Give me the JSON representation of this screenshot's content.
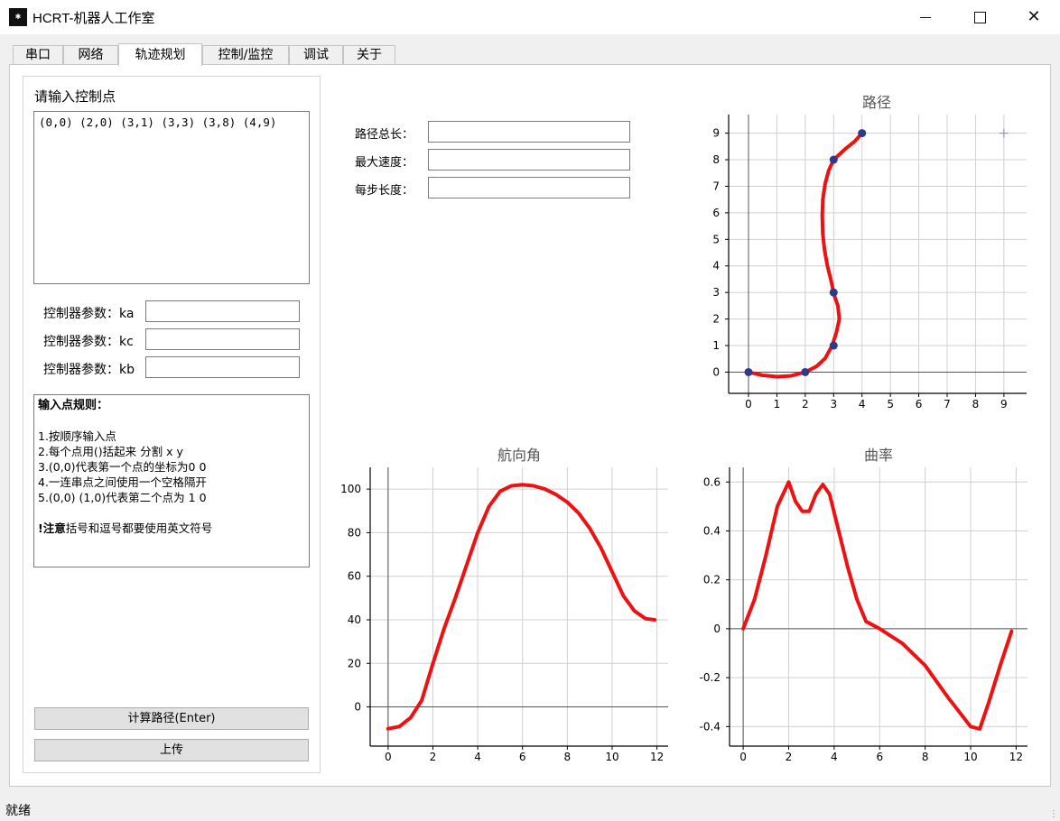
{
  "window": {
    "title": "HCRT-机器人工作室",
    "icon_text": "logo"
  },
  "tabs": [
    "串口",
    "网络",
    "轨迹规划",
    "控制/监控",
    "调试",
    "关于"
  ],
  "active_tab": "轨迹规划",
  "left": {
    "input_label": "请输入控制点",
    "control_points_value": "(0,0) (2,0) (3,1) (3,3) (3,8) (4,9)",
    "params": [
      {
        "label": "控制器参数：ka",
        "value": ""
      },
      {
        "label": "控制器参数：kc",
        "value": ""
      },
      {
        "label": "控制器参数：kb",
        "value": ""
      }
    ],
    "rules": {
      "title": "输入点规则：",
      "lines": [
        "1.按顺序输入点",
        "2.每个点用()括起来 分割 x y",
        "3.(0,0)代表第一个点的坐标为0 0",
        "4.一连串点之间使用一个空格隔开",
        "5.(0,0) (1,0)代表第二个点为 1 0"
      ],
      "note_bold": "!注意",
      "note_rest": "括号和逗号都要使用英文符号"
    },
    "compute_button": "计算路径(Enter)",
    "upload_button": "上传"
  },
  "metrics": [
    {
      "label": "路径总长：",
      "value": ""
    },
    {
      "label": "最大速度：",
      "value": ""
    },
    {
      "label": "每步长度：",
      "value": ""
    }
  ],
  "status": "就绪",
  "chart_data": [
    {
      "type": "scatter",
      "title": "路径",
      "xlim": [
        -0.7,
        9.8
      ],
      "ylim": [
        -0.8,
        9.7
      ],
      "xticks": [
        0,
        1,
        2,
        3,
        4,
        5,
        6,
        7,
        8,
        9
      ],
      "yticks": [
        0,
        1,
        2,
        3,
        4,
        5,
        6,
        7,
        8,
        9
      ],
      "grid": true,
      "control_points": [
        [
          0,
          0
        ],
        [
          2,
          0
        ],
        [
          3,
          1
        ],
        [
          3,
          3
        ],
        [
          3,
          8
        ],
        [
          4,
          9
        ]
      ],
      "path_x": [
        0,
        0.5,
        1,
        1.5,
        2,
        2.4,
        2.7,
        2.95,
        3.1,
        3.2,
        3.15,
        3.05,
        3,
        2.9,
        2.78,
        2.68,
        2.62,
        2.6,
        2.62,
        2.7,
        2.83,
        3,
        3.4,
        3.75,
        4
      ],
      "path_y": [
        0,
        -0.12,
        -0.17,
        -0.14,
        0,
        0.22,
        0.52,
        1,
        1.5,
        2,
        2.5,
        2.8,
        3,
        3.5,
        4,
        4.6,
        5.2,
        5.9,
        6.5,
        7.1,
        7.6,
        8,
        8.4,
        8.7,
        9
      ],
      "cursor_marker": [
        9,
        9
      ],
      "line_color": "#ee1111",
      "point_color": "#2e3a8c"
    },
    {
      "type": "line",
      "title": "航向角",
      "xlim": [
        -0.8,
        12.5
      ],
      "ylim": [
        -18,
        110
      ],
      "xticks": [
        0,
        2,
        4,
        6,
        8,
        10,
        12
      ],
      "yticks": [
        0,
        20,
        40,
        60,
        80,
        100
      ],
      "grid": true,
      "x": [
        0,
        0.5,
        1,
        1.5,
        2,
        2.5,
        3,
        3.5,
        4,
        4.5,
        5,
        5.5,
        6,
        6.5,
        7,
        7.5,
        8,
        8.5,
        9,
        9.5,
        10,
        10.5,
        11,
        11.5,
        11.9
      ],
      "y": [
        -10,
        -9,
        -5,
        3,
        20,
        36,
        50,
        65,
        80,
        92,
        99,
        101.5,
        102,
        101.5,
        100,
        97.5,
        94,
        89,
        82,
        73,
        62,
        51,
        44,
        40.5,
        40
      ],
      "line_color": "#ee1111"
    },
    {
      "type": "line",
      "title": "曲率",
      "xlim": [
        -0.6,
        12.5
      ],
      "ylim": [
        -0.48,
        0.66
      ],
      "xticks": [
        0,
        2,
        4,
        6,
        8,
        10,
        12
      ],
      "yticks": [
        0.6,
        0.4,
        0.2,
        0,
        -0.2,
        -0.4
      ],
      "grid": true,
      "x": [
        0,
        0.5,
        1,
        1.5,
        2,
        2.3,
        2.6,
        2.9,
        3.2,
        3.5,
        3.8,
        4.2,
        4.6,
        5,
        5.4,
        6,
        7,
        8,
        9,
        10,
        10.4,
        10.8,
        11.3,
        11.8
      ],
      "y": [
        0,
        0.12,
        0.3,
        0.5,
        0.6,
        0.52,
        0.48,
        0.48,
        0.55,
        0.59,
        0.55,
        0.4,
        0.25,
        0.12,
        0.03,
        0,
        -0.06,
        -0.15,
        -0.28,
        -0.4,
        -0.41,
        -0.3,
        -0.15,
        -0.01
      ],
      "line_color": "#ee1111"
    }
  ]
}
